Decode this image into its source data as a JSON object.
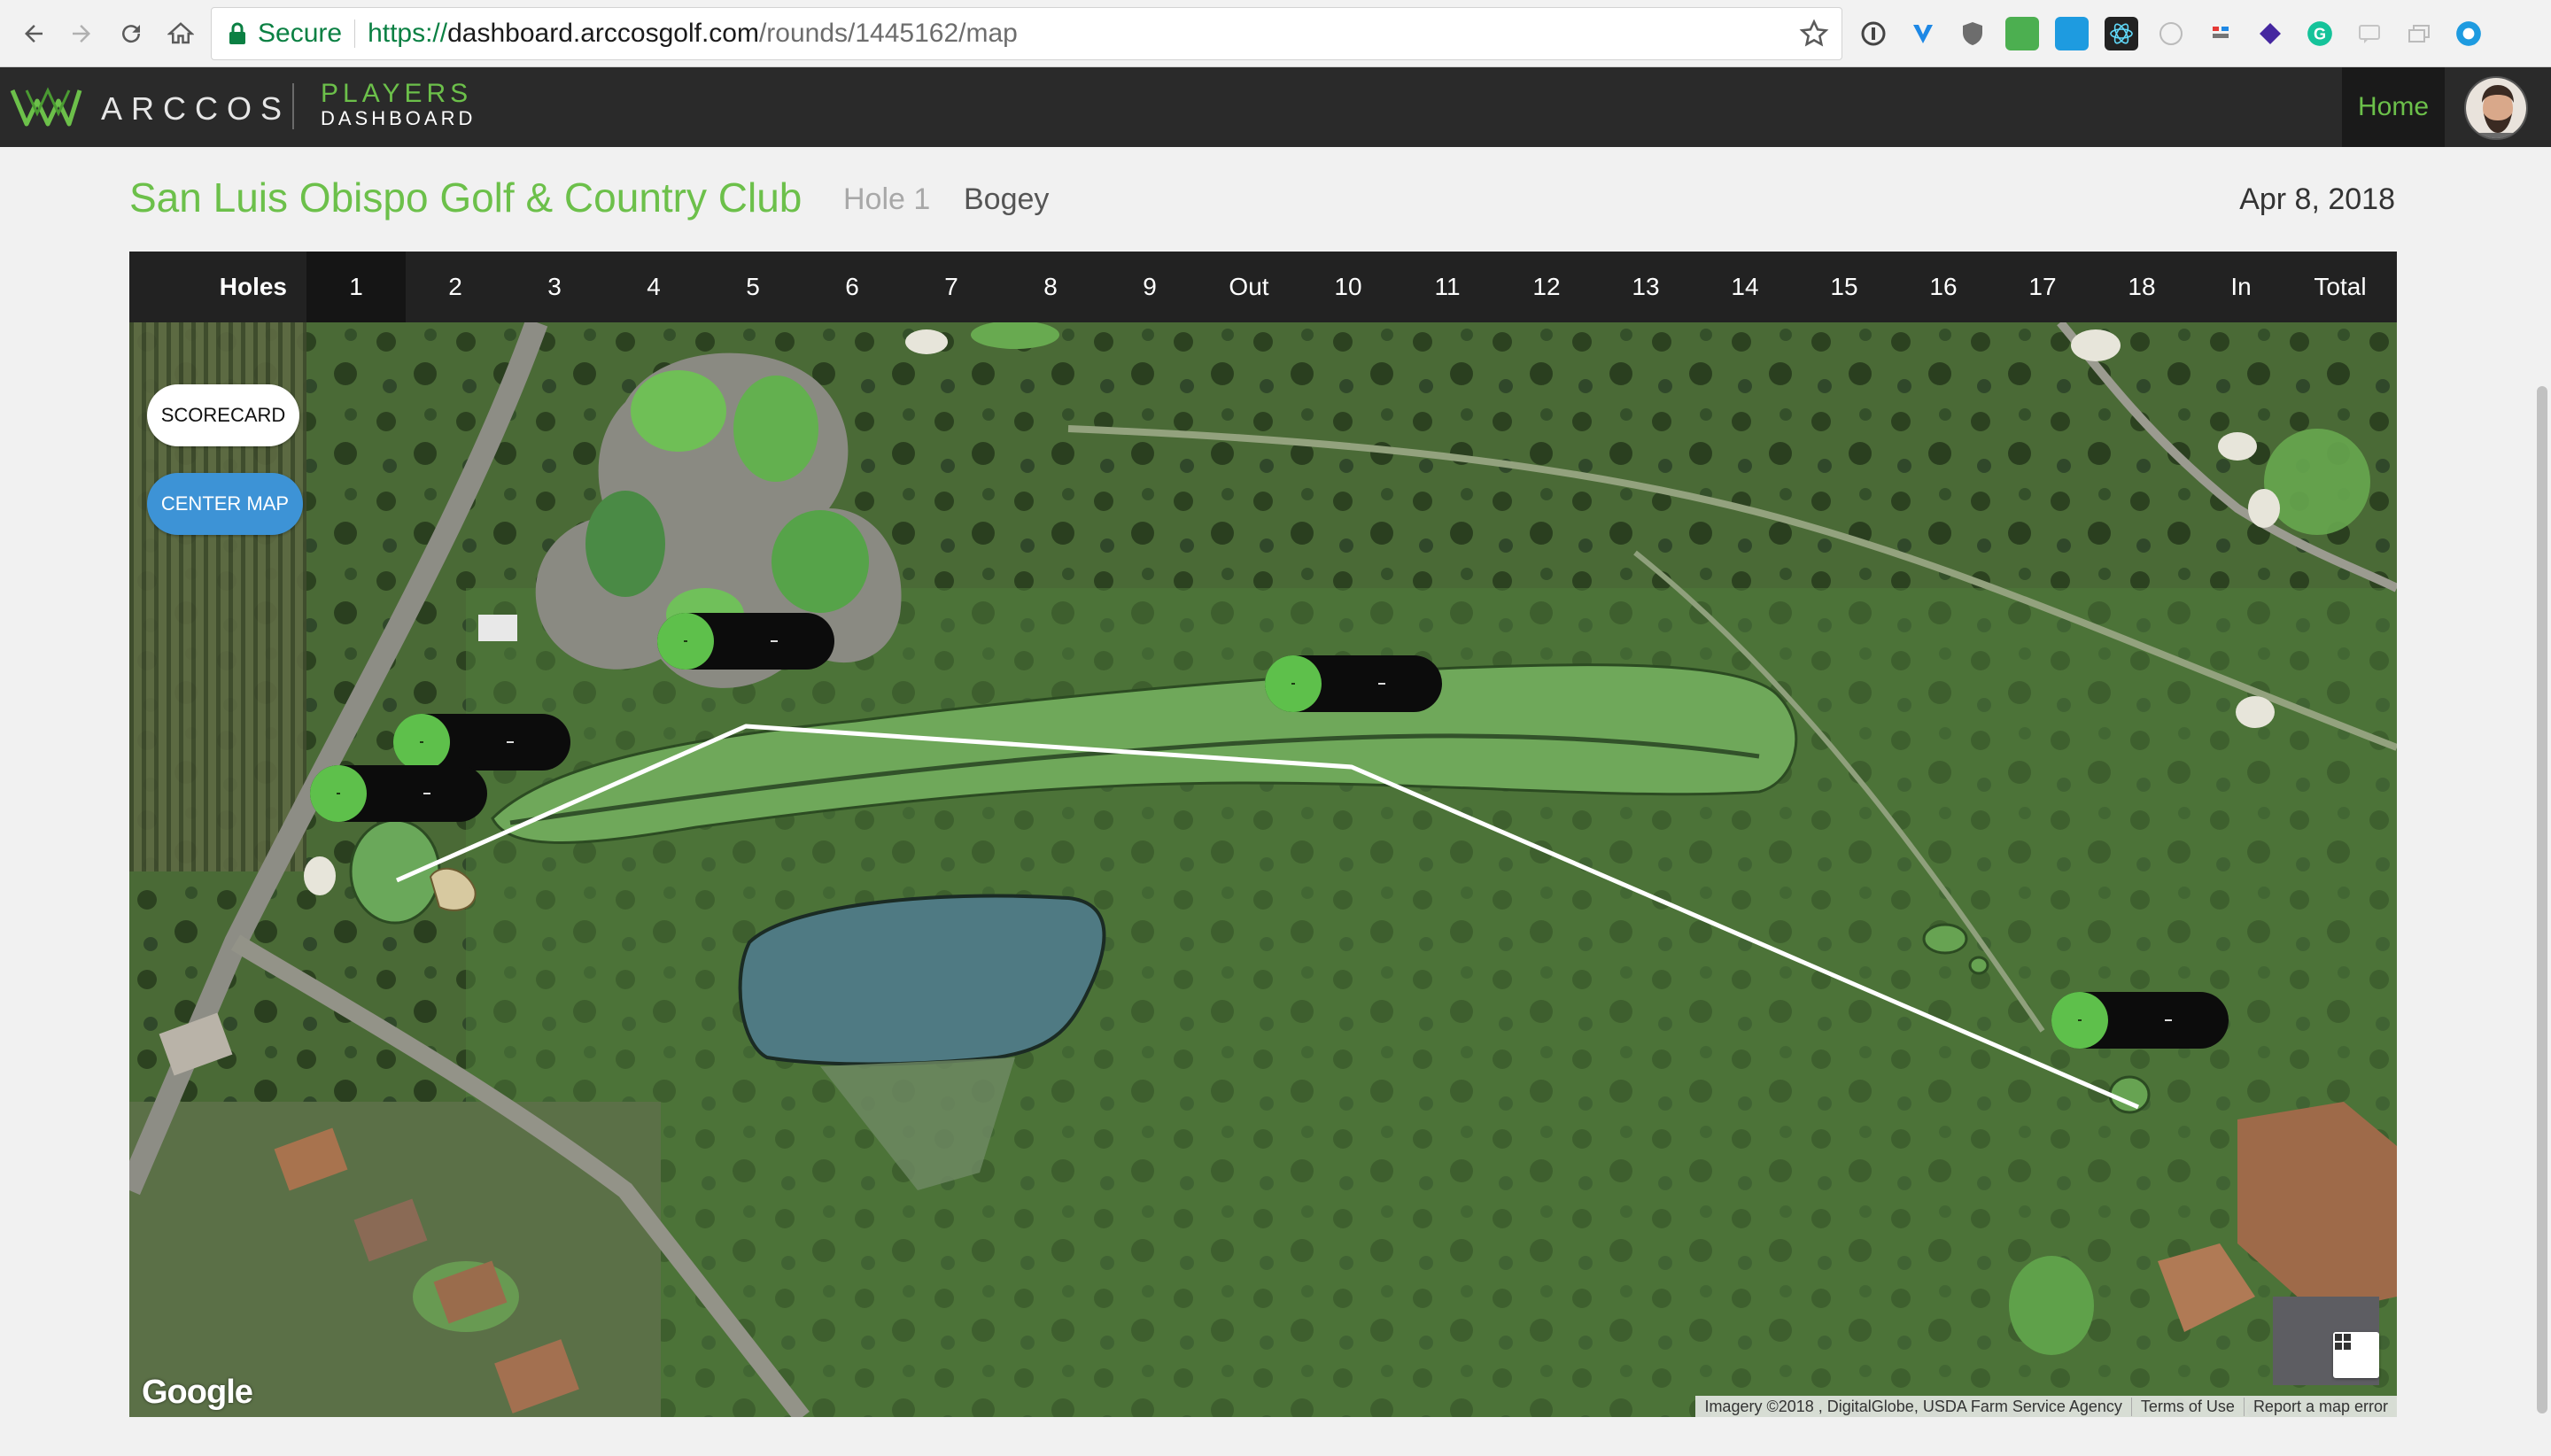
{
  "browser": {
    "secure_label": "Secure",
    "url_protocol": "https://",
    "url_host": "dashboard.arccosgolf.com",
    "url_path": "/rounds/1445162/map"
  },
  "app": {
    "brand": "ARCCOS",
    "sub_top": "PLAYERS",
    "sub_bottom": "DASHBOARD",
    "home_label": "Home",
    "accent_color": "#6cc04a"
  },
  "round": {
    "course": "San Luis Obispo Golf & Country Club",
    "hole": "Hole 1",
    "score": "Bogey",
    "date": "Apr 8, 2018"
  },
  "holes_bar": {
    "label": "Holes",
    "active": "1",
    "items": [
      "1",
      "2",
      "3",
      "4",
      "5",
      "6",
      "7",
      "8",
      "9",
      "Out",
      "10",
      "11",
      "12",
      "13",
      "14",
      "15",
      "16",
      "17",
      "18",
      "In",
      "Total"
    ]
  },
  "map": {
    "scorecard_label": "SCORECARD",
    "center_label": "CENTER MAP",
    "google_label": "Google",
    "attribution": "Imagery ©2018 , DigitalGlobe, USDA Farm Service Agency",
    "terms": "Terms of Use",
    "report": "Report a map error",
    "shot_marker_color": "#5ec04b",
    "shot_marker_count": 5,
    "shot_line_color": "#ffffff"
  }
}
